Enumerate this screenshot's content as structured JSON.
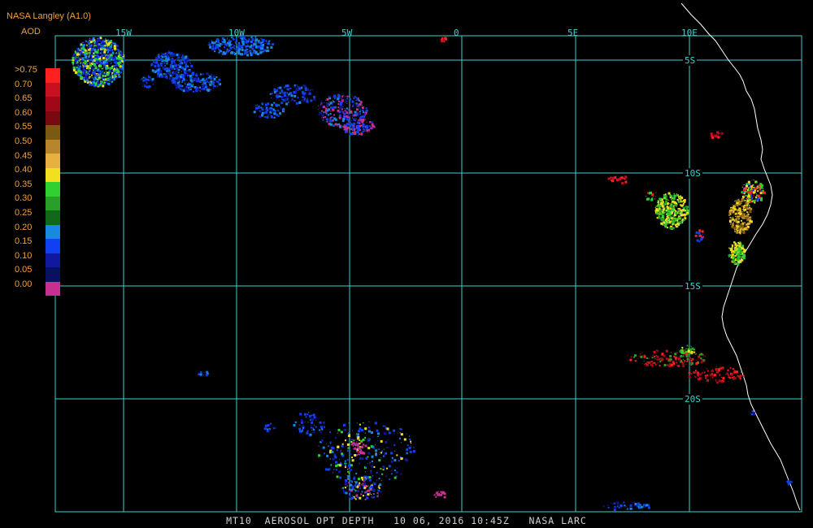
{
  "header": {
    "source": "NASA Langley (A1.0)",
    "unit": "AOD"
  },
  "legend": {
    "labels": [
      ">0.75",
      "0.70",
      "0.65",
      "0.60",
      "0.55",
      "0.50",
      "0.45",
      "0.40",
      "0.35",
      "0.30",
      "0.25",
      "0.20",
      "0.15",
      "0.10",
      "0.05",
      "0.00"
    ],
    "colors": [
      "#ff2020",
      "#c81020",
      "#a00818",
      "#7a0810",
      "#7a5a10",
      "#b8862a",
      "#e8b040",
      "#f0e020",
      "#30d030",
      "#28a028",
      "#106818",
      "#1888e0",
      "#1040f0",
      "#1018a0",
      "#081060",
      "#c83090"
    ]
  },
  "grid": {
    "lon_labels": [
      "15W",
      "10W",
      "5W",
      "0",
      "5E",
      "10E"
    ],
    "lat_labels": [
      "5S",
      "10S",
      "15S",
      "20S"
    ],
    "line_color": "#40d0d0",
    "coast_color": "#ffffff"
  },
  "footer": {
    "text": "MT10  AEROSOL OPT DEPTH   10 06, 2016 10:45Z   NASA LARC"
  }
}
